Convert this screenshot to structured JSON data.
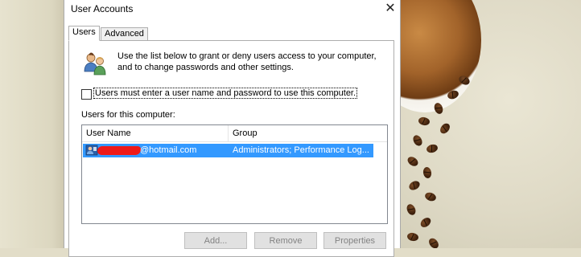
{
  "window": {
    "title": "User Accounts",
    "close_glyph": "✕"
  },
  "tabs": [
    {
      "label": "Users",
      "active": true
    },
    {
      "label": "Advanced",
      "active": false
    }
  ],
  "users_tab": {
    "intro_line1": "Use the list below to grant or deny users access to your computer,",
    "intro_line2": "and to change passwords and other settings.",
    "require_password_checkbox": {
      "label": "Users must enter a user name and password to use this computer.",
      "checked": false
    },
    "users_list_label": "Users for this computer:",
    "columns": [
      "User Name",
      "Group"
    ],
    "rows": [
      {
        "user_name_visible": "@hotmail.com",
        "user_name_redacted": true,
        "group": "Administrators; Performance Log...",
        "selected": true
      }
    ],
    "buttons": {
      "add": {
        "label": "Add...",
        "enabled": false
      },
      "remove": {
        "label": "Remove",
        "enabled": false
      },
      "properties": {
        "label": "Properties",
        "enabled": false
      }
    }
  },
  "icons": {
    "users": "users-icon",
    "user_row": "user-account-icon",
    "close": "close-icon"
  },
  "colors": {
    "selection": "#3399ff",
    "redaction": "#ee1a1a",
    "disabled_text": "#838383"
  }
}
